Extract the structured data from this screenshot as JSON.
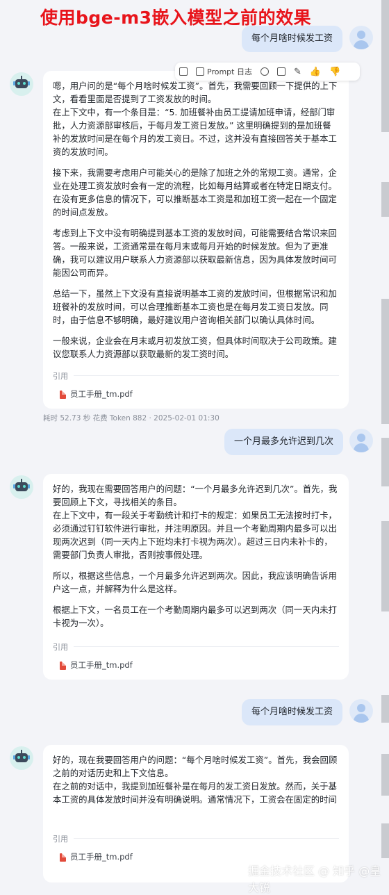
{
  "banner_title": "使用bge-m3嵌入模型之前的效果",
  "toolbar": {
    "prompt_log": "Prompt 日志"
  },
  "messages": [
    {
      "role": "user",
      "text": "每个月啥时候发工资"
    },
    {
      "role": "assistant",
      "paragraphs": [
        "嗯，用户问的是“每个月啥时候发工资”。首先，我需要回顾一下提供的上下文，看看里面是否提到了工资发放的时间。\n在上下文中，有一个条目是：“5. 加班餐补由员工提请加班申请，经部门审批，人力资源部审核后，于每月发工资日发放。” 这里明确提到的是加班餐补的发放时间是在每个月的发工资日。不过，这并没有直接回答关于基本工资的发放时间。",
        "接下来，我需要考虑用户可能关心的是除了加班之外的常规工资。通常，企业在处理工资发放时会有一定的流程，比如每月结算或者在特定日期支付。在没有更多信息的情况下，可以推断基本工资是和加班工资一起在一个固定的时间点发放。",
        "考虑到上下文中没有明确提到基本工资的发放时间，可能需要结合常识来回答。一般来说，工资通常是在每月末或每月开始的时候发放。但为了更准确，我可以建议用户联系人力资源部以获取最新信息，因为具体发放时间可能因公司而异。",
        "总结一下，虽然上下文没有直接说明基本工资的发放时间，但根据常识和加班餐补的发放时间，可以合理推断基本工资也是在每月发工资日发放。同时，由于信息不够明确，最好建议用户咨询相关部门以确认具体时间。",
        "一般来说，企业会在月末或月初发放工资，但具体时间取决于公司政策。建议您联系人力资源部以获取最新的发工资时间。"
      ],
      "citation_label": "引用",
      "citation_file": "员工手册_tm.pdf",
      "meta": "耗时 52.73 秒  花费 Token 882  ·  2025-02-01 01:30"
    },
    {
      "role": "user",
      "text": "一个月最多允许迟到几次"
    },
    {
      "role": "assistant",
      "paragraphs": [
        "好的，我现在需要回答用户的问题：“一个月最多允许迟到几次”。首先，我要回顾上下文，寻找相关的条目。\n在上下文中，有一段关于考勤统计和打卡的规定：如果员工无法按时打卡，必须通过钉钉软件进行审批，并注明原因。并且一个考勤周期内最多可以出现两次迟到（同一天内上下班均未打卡视为两次）。超过三日内未补卡的，需要部门负责人审批，否则按事假处理。",
        "所以，根据这些信息，一个月最多允许迟到两次。因此，我应该明确告诉用户这一点，并解释为什么是这样。",
        "根据上下文，一名员工在一个考勤周期内最多可以迟到两次（同一天内未打卡视为一次）。"
      ],
      "citation_label": "引用",
      "citation_file": "员工手册_tm.pdf"
    },
    {
      "role": "user",
      "text": "每个月啥时候发工资"
    },
    {
      "role": "assistant",
      "paragraphs": [
        "好的，现在我要回答用户的问题：“每个月啥时候发工资”。首先，我会回顾之前的对话历史和上下文信息。\n在之前的对话中，我提到加班餐补是在每月的发工资日发放。然而，关于基本工资的具体发放时间并没有明确说明。通常情况下，工资会在固定的时间"
      ],
      "citation_label": "引用",
      "citation_file": "员工手册_tm.pdf"
    }
  ],
  "watermark": "掘金技术社区 @ 知乎 @皇大锐",
  "colors": {
    "banner": "#e8141b",
    "user_bubble": "#dbe7f9",
    "background": "#f3f4f8"
  }
}
